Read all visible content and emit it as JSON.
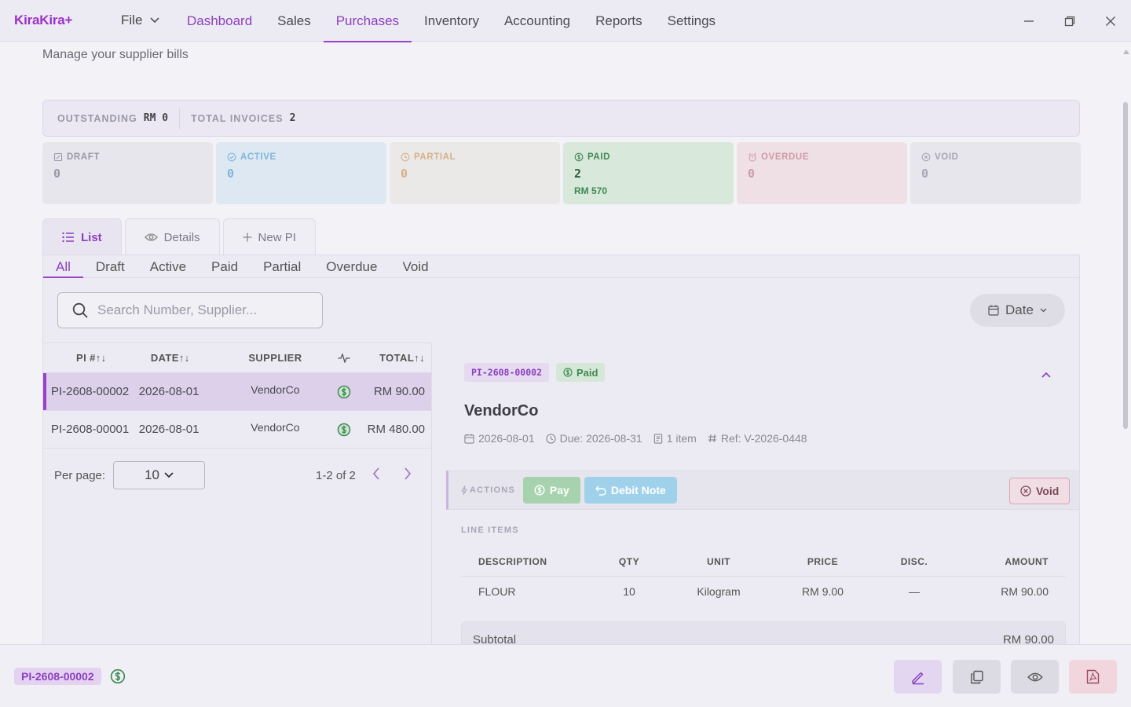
{
  "app": {
    "logo": "KiraKira+"
  },
  "menu": {
    "file_label": "File"
  },
  "nav": [
    {
      "label": "Dashboard",
      "style": "purple"
    },
    {
      "label": "Sales",
      "style": ""
    },
    {
      "label": "Purchases",
      "style": "purple active"
    },
    {
      "label": "Inventory",
      "style": ""
    },
    {
      "label": "Accounting",
      "style": ""
    },
    {
      "label": "Reports",
      "style": ""
    },
    {
      "label": "Settings",
      "style": ""
    }
  ],
  "page": {
    "subtitle": "Manage your supplier bills"
  },
  "summary": {
    "outstanding_label": "OUTSTANDING",
    "outstanding_value": "RM 0",
    "total_label": "TOTAL INVOICES",
    "total_value": "2"
  },
  "status_cards": [
    {
      "label": "DRAFT",
      "count": "0",
      "amount": "",
      "bg": "#e7e6ec",
      "fg": "#9a98a6"
    },
    {
      "label": "ACTIVE",
      "count": "0",
      "amount": "",
      "bg": "#dde8f3",
      "fg": "#7fb6d8"
    },
    {
      "label": "PARTIAL",
      "count": "0",
      "amount": "",
      "bg": "#ebe8e8",
      "fg": "#d4b28a"
    },
    {
      "label": "PAID",
      "count": "2",
      "amount": "RM 570",
      "bg": "#d8e8db",
      "fg": "#3f8a52"
    },
    {
      "label": "OVERDUE",
      "count": "0",
      "amount": "",
      "bg": "#efe0e6",
      "fg": "#cf9aa8"
    },
    {
      "label": "VOID",
      "count": "0",
      "amount": "",
      "bg": "#e7e6ec",
      "fg": "#a8a6b2"
    }
  ],
  "view_tabs": {
    "list": "List",
    "details": "Details",
    "new": "New PI"
  },
  "filter_tabs": [
    "All",
    "Draft",
    "Active",
    "Paid",
    "Partial",
    "Overdue",
    "Void"
  ],
  "search": {
    "placeholder": "Search Number, Supplier..."
  },
  "date_filter": {
    "label": "Date"
  },
  "table": {
    "headers": {
      "pi": "PI #↑↓",
      "date": "DATE↑↓",
      "supplier": "SUPPLIER",
      "total": "TOTAL↑↓"
    },
    "rows": [
      {
        "pi": "PI-2608-00002",
        "date": "2026-08-01",
        "supplier": "VendorCo",
        "total": "RM 90.00"
      },
      {
        "pi": "PI-2608-00001",
        "date": "2026-08-01",
        "supplier": "VendorCo",
        "total": "RM 480.00"
      }
    ]
  },
  "pagination": {
    "per_page_label": "Per page:",
    "per_page_value": "10",
    "range": "1-2 of 2"
  },
  "detail": {
    "number": "PI-2608-00002",
    "status": "Paid",
    "supplier": "VendorCo",
    "date": "2026-08-01",
    "due": "Due: 2026-08-31",
    "items": "1 item",
    "ref": "Ref: V-2026-0448",
    "actions_label": "ACTIONS",
    "pay_label": "Pay",
    "debit_label": "Debit Note",
    "void_label": "Void",
    "line_items_label": "LINE ITEMS",
    "line_headers": {
      "description": "DESCRIPTION",
      "qty": "QTY",
      "unit": "UNIT",
      "price": "PRICE",
      "disc": "DISC.",
      "amount": "AMOUNT"
    },
    "lines": [
      {
        "description": "FLOUR",
        "qty": "10",
        "unit": "Kilogram",
        "price": "RM 9.00",
        "disc": "—",
        "amount": "RM 90.00"
      }
    ],
    "subtotal_label": "Subtotal",
    "subtotal_value": "RM 90.00"
  },
  "footer": {
    "badge": "PI-2608-00002"
  },
  "colors": {
    "accent": "#9b3fd0",
    "paid_green": "#3f8a52"
  }
}
